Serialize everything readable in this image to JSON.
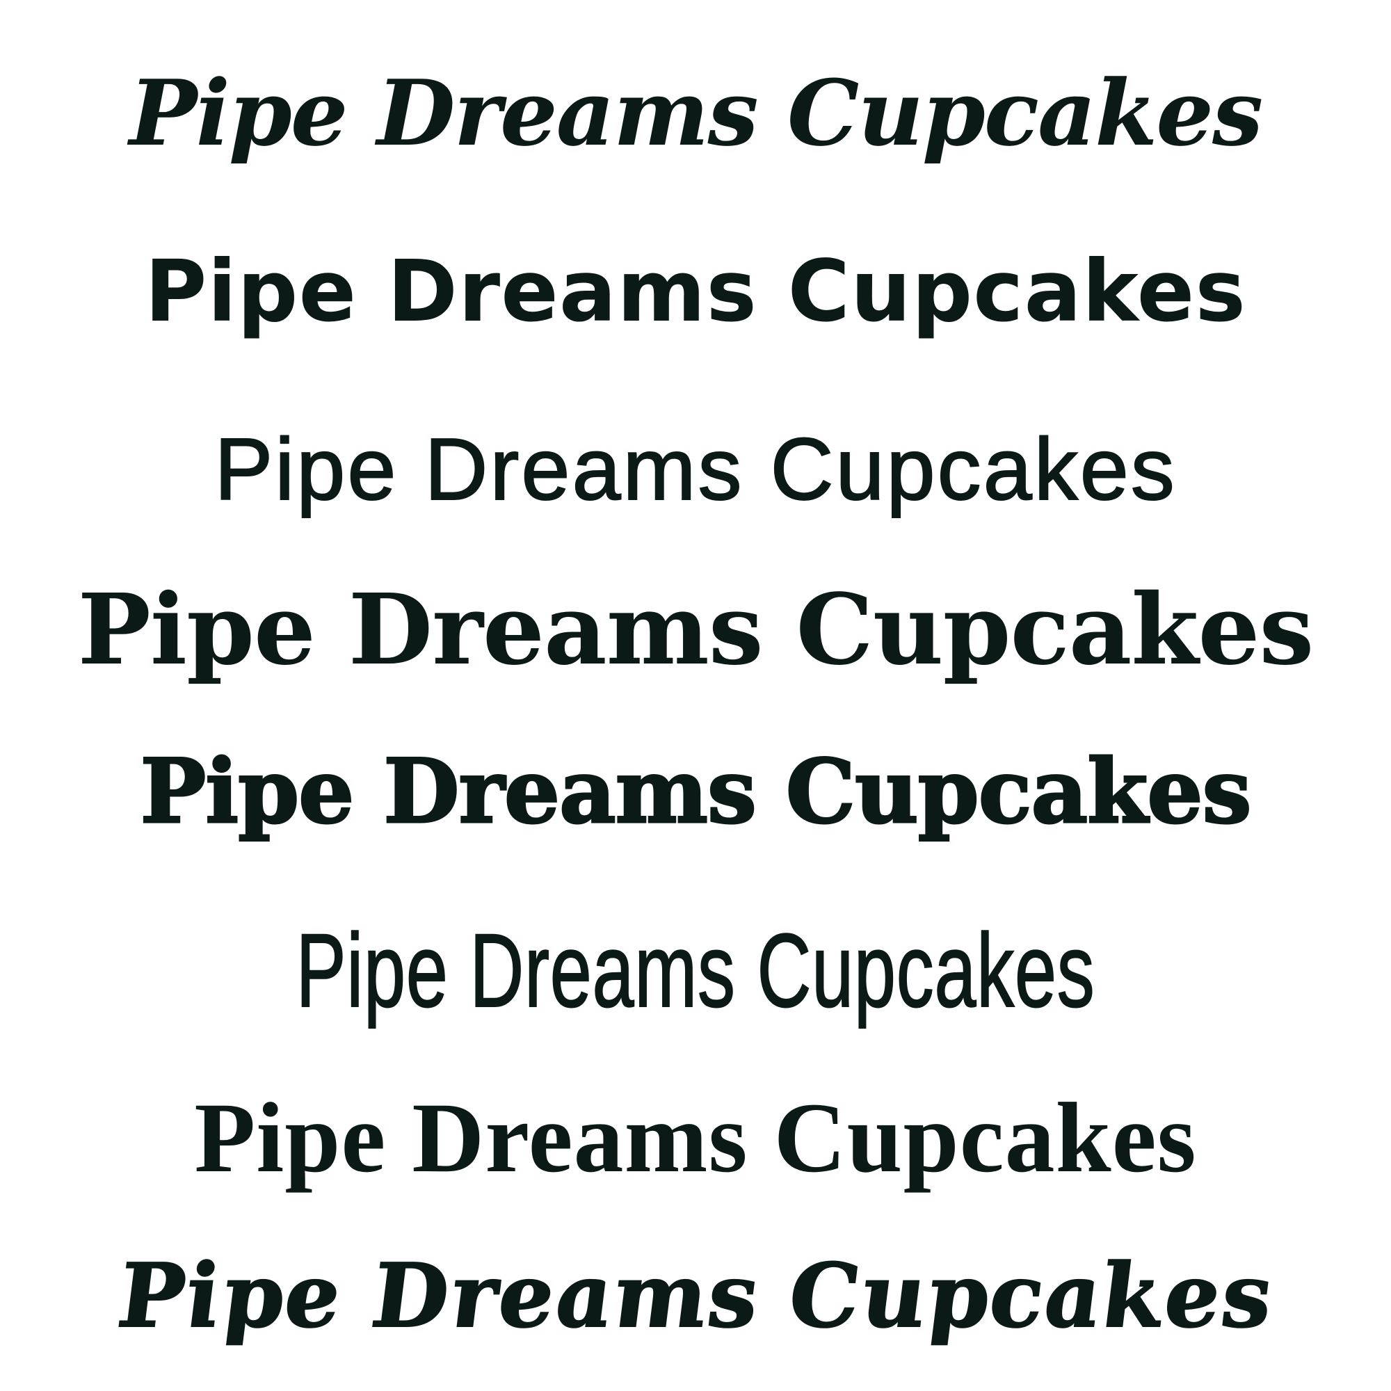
{
  "ink_color": "#0b1a16",
  "background_color": "#ffffff",
  "samples": [
    {
      "style": "retro-swash-italic",
      "text": "Pipe Dreams Cupcakes"
    },
    {
      "style": "heavy-geometric-sans",
      "text": "Pipe Dreams Cupcakes"
    },
    {
      "style": "geometric-sans",
      "text": "Pipe Dreams Cupcakes"
    },
    {
      "style": "bold-transitional-serif",
      "text": "Pipe Dreams Cupcakes"
    },
    {
      "style": "chunky-wedge-serif",
      "text": "Pipe Dreams Cupcakes"
    },
    {
      "style": "condensed-sans",
      "text": "Pipe Dreams Cupcakes"
    },
    {
      "style": "soft-display-serif",
      "text": "Pipe Dreams Cupcakes"
    },
    {
      "style": "groovy-wavy-display",
      "text": "Pipe Dreams Cupcakes"
    }
  ]
}
